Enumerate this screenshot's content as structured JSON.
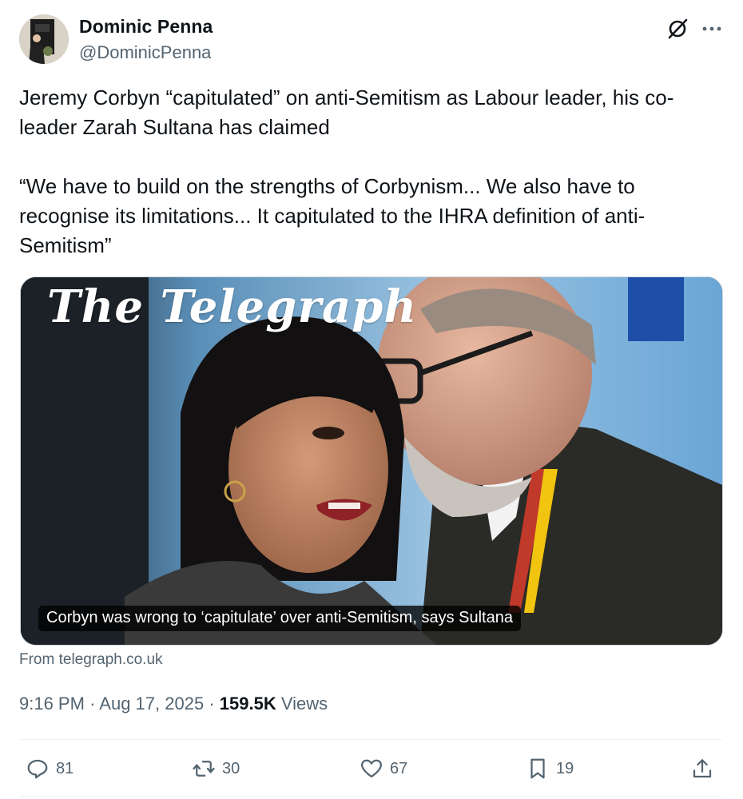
{
  "author": {
    "name": "Dominic Penna",
    "handle": "@DominicPenna"
  },
  "icons": {
    "grok": "grok-icon",
    "more": "more-icon",
    "reply": "reply-icon",
    "repost": "repost-icon",
    "like": "heart-icon",
    "bookmark": "bookmark-icon",
    "share": "share-icon"
  },
  "tweet": {
    "paragraph1": "Jeremy Corbyn “capitulated” on anti-Semitism as Labour leader, his co-\nleader Zarah Sultana has claimed",
    "paragraph2": "“We have to build on the strengths of Corbynism... We also have to\nrecognise its limitations... It capitulated to the IHRA definition of anti-\nSemitism”"
  },
  "card": {
    "masthead": "The Telegraph",
    "caption": "Corbyn was wrong to ‘capitulate’ over anti-Semitism, says Sultana",
    "source": "From telegraph.co.uk"
  },
  "meta": {
    "time": "9:16 PM",
    "date": "Aug 17, 2025",
    "separator": "·",
    "views_count": "159.5K",
    "views_label": "Views"
  },
  "actions": {
    "replies": "81",
    "reposts": "30",
    "likes": "67",
    "bookmarks": "19"
  },
  "colors": {
    "text": "#0f1419",
    "secondary": "#536471",
    "divider": "#eff3f4"
  }
}
